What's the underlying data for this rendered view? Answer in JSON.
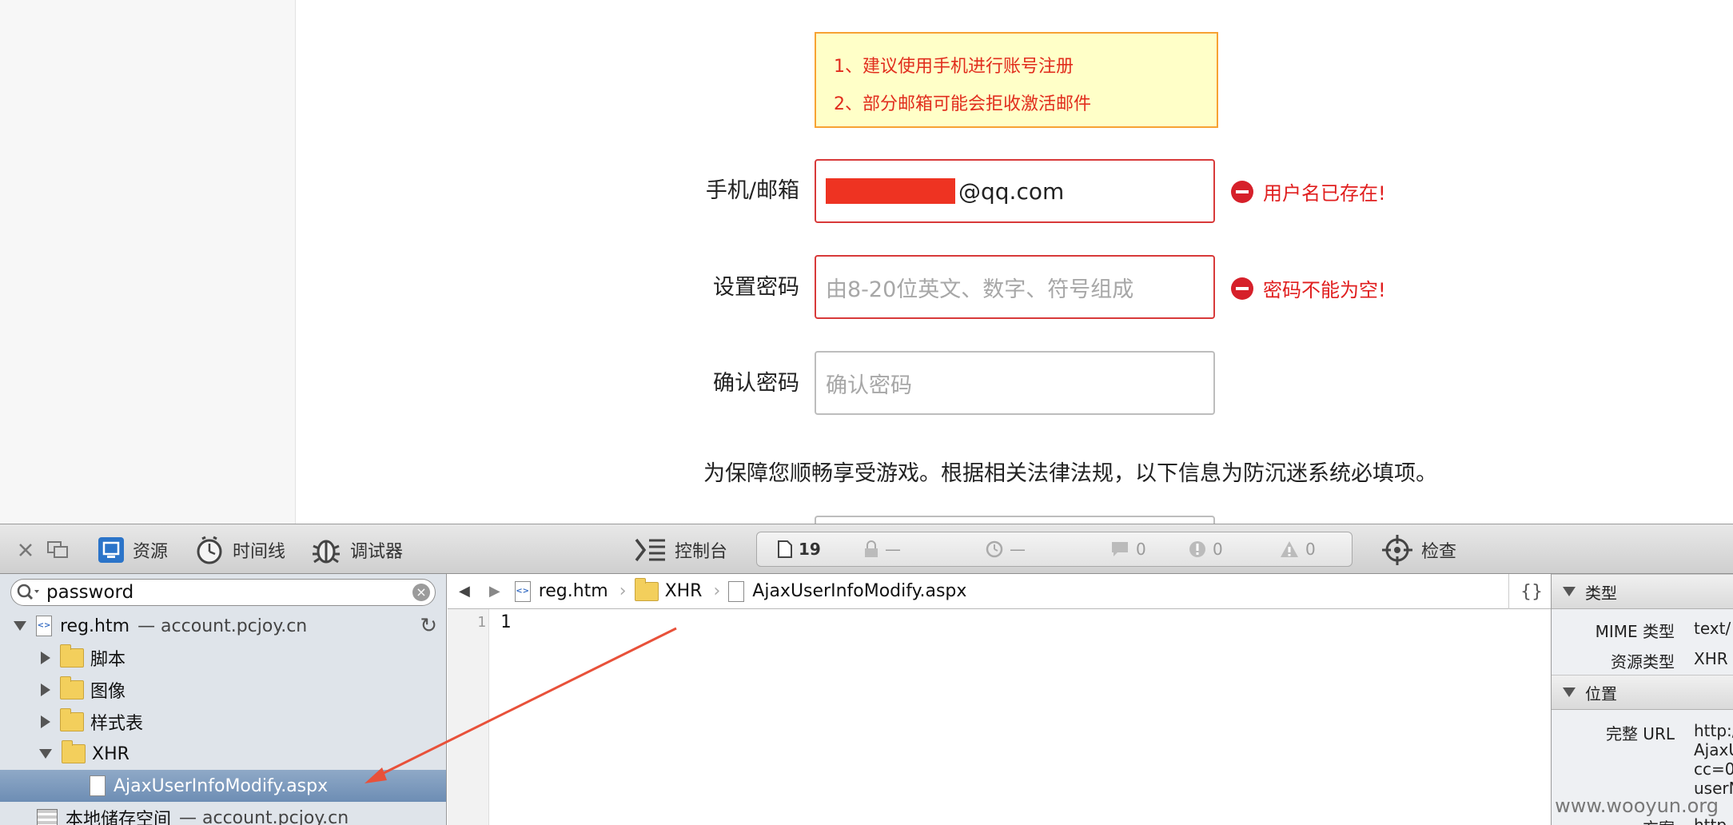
{
  "form": {
    "notices": [
      "1、建议使用手机进行账号注册",
      "2、部分邮箱可能会拒收激活邮件"
    ],
    "username_label": "手机/邮箱",
    "username_value": "@qq.com",
    "username_error": "用户名已存在!",
    "password_label": "设置密码",
    "password_placeholder": "由8-20位英文、数字、符号组成",
    "password_error": "密码不能为空!",
    "confirm_label": "确认密码",
    "confirm_placeholder": "确认密码",
    "law_text": "为保障您顺畅享受游戏。根据相关法律法规，以下信息为防沉迷系统必填项。"
  },
  "toolbar": {
    "resources": "资源",
    "timeline": "时间线",
    "debugger": "调试器",
    "console": "控制台",
    "inspect": "检查",
    "counts": {
      "resources": "19",
      "lock": "—",
      "time": "—",
      "logs": "0",
      "errors": "0",
      "warnings": "0"
    }
  },
  "sidebar": {
    "search_value": "password",
    "tree": {
      "root_name": "reg.htm",
      "root_domain": "— account.pcjoy.cn",
      "scripts": "脚本",
      "images": "图像",
      "stylesheets": "样式表",
      "xhr": "XHR",
      "xhr_file": "AjaxUserInfoModify.aspx",
      "storage_name": "本地储存空间",
      "storage_domain": "— account.pcjoy.cn"
    }
  },
  "code": {
    "breadcrumb": [
      "reg.htm",
      "XHR",
      "AjaxUserInfoModify.aspx"
    ],
    "line_number": "1",
    "line_text": "1",
    "format_button": "{}"
  },
  "details": {
    "type_header": "类型",
    "mime_label": "MIME 类型",
    "mime_value": "text/",
    "resource_type_label": "资源类型",
    "resource_type_value": "XHR",
    "location_header": "位置",
    "full_url_label": "完整 URL",
    "url_lines": [
      "http:/",
      "AjaxU",
      "cc=0",
      "userN"
    ],
    "scheme_label": "方案",
    "scheme_value": "http"
  },
  "watermark": "www.wooyun.org",
  "colors": {
    "error_red": "#e01e1e",
    "notice_bg": "#ffffc8",
    "notice_border": "#f7a233",
    "selection": "#7693b8",
    "arrow": "#e8513a"
  }
}
